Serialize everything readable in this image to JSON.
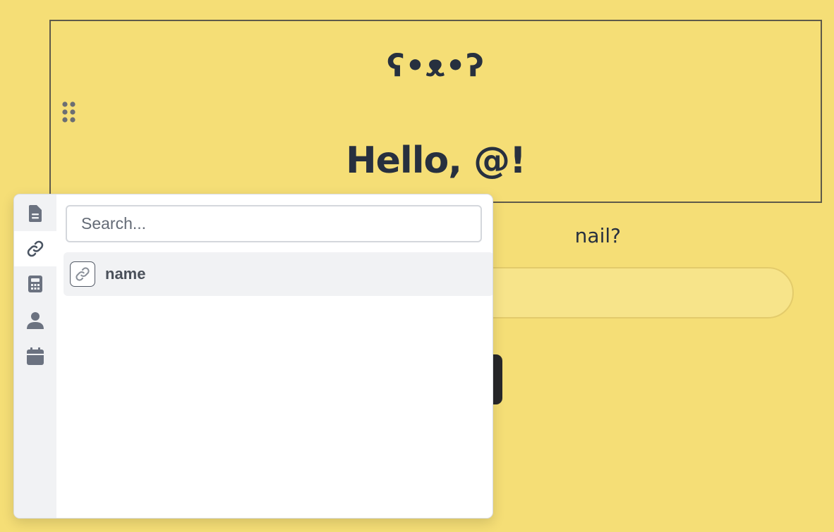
{
  "header_block": {
    "emoji": "ʕ•ᴥ•ʔ",
    "greeting": "Hello, @!"
  },
  "form": {
    "question_visible_text": "nail?"
  },
  "popover": {
    "search": {
      "placeholder": "Search...",
      "value": ""
    },
    "tabs": [
      {
        "icon": "document-icon",
        "active": false
      },
      {
        "icon": "link-icon",
        "active": true
      },
      {
        "icon": "calculator-icon",
        "active": false
      },
      {
        "icon": "person-icon",
        "active": false
      },
      {
        "icon": "calendar-icon",
        "active": false
      }
    ],
    "results": [
      {
        "icon": "link-icon",
        "label": "name",
        "highlighted": true
      }
    ]
  },
  "colors": {
    "page_background": "#f5de76",
    "text_dark": "#27303f",
    "popover_background": "#ffffff",
    "rail_background": "#f1f2f4",
    "button_background": "#27272a"
  }
}
